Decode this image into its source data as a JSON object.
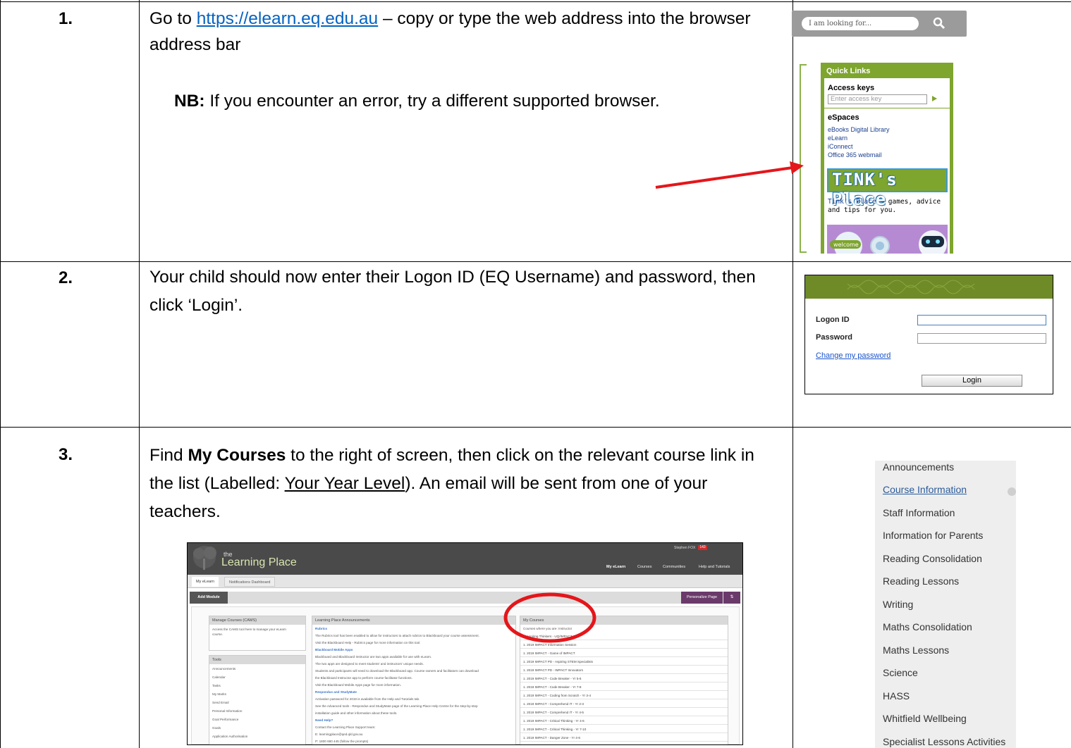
{
  "steps": [
    {
      "number": "1.",
      "text_before": "Go to ",
      "link": "https://elearn.eq.edu.au",
      "text_after": " – copy or type the web address into the browser address bar",
      "note_label": "NB:",
      "note_text": " If you encounter an error, try a different supported browser."
    },
    {
      "number": "2.",
      "text": "Your child should now enter their Logon ID (EQ Username) and password, then click ‘Login’."
    },
    {
      "number": "3.",
      "text_1": "Find ",
      "bold": "My Courses",
      "text_2": " to the right of screen, then click on the relevant course link in the list (Labelled: ",
      "underlined": "Your Year Level",
      "text_3": ").  An email will be sent from one of your teachers."
    }
  ],
  "search": {
    "placeholder": "I am looking for..."
  },
  "quick_links": {
    "title": "Quick Links",
    "access_keys": "Access keys",
    "access_placeholder": "Enter access key",
    "espaces": "eSpaces",
    "links": [
      "eBooks Digital Library",
      "eLearn",
      "iConnect",
      "Office 365 webmail"
    ],
    "tink_title": "TINK's Place",
    "tink_link": "Tink's Place",
    "tink_desc": " – games, advice and tips for you.",
    "welcome": "welcome"
  },
  "login": {
    "logon_label": "Logon ID",
    "password_label": "Password",
    "change_password": "Change my password",
    "button": "Login"
  },
  "course_menu": [
    "Announcements",
    "Course Information",
    "Staff Information",
    "Information for Parents",
    "Reading Consolidation",
    "Reading Lessons",
    "Writing",
    "Maths Consolidation",
    "Maths Lessons",
    "Science",
    "HASS",
    "Whitfield Wellbeing",
    "Specialist Lessons Activities"
  ],
  "learning_place": {
    "logo_the": "the",
    "logo": "Learning Place",
    "user": "Stephen FOX",
    "badge": "143",
    "nav": [
      "My eLearn",
      "Courses",
      "Communities",
      "Help and Tutorials"
    ],
    "tabs": [
      "My eLearn",
      "Notifications Dashboard"
    ],
    "add_module": "Add Module",
    "personalize": "Personalize Page",
    "manage_title": "Manage Courses (CAMS)",
    "manage_text_1": "Access the CAMS tool here to manage your eLearn",
    "manage_text_2": "course.",
    "tools_title": "Tools",
    "tools": [
      "Announcements",
      "Calendar",
      "Tasks",
      "My Marks",
      "Send Email",
      "Personal Information",
      "Goal Performance",
      "Goals",
      "Application Authorisation"
    ],
    "announce_title": "Learning Place Announcements",
    "announce_lines": [
      {
        "t": "Rubrics",
        "h": true
      },
      {
        "t": "The Rubrics tool has been enabled to allow for instructors to attach rubrics to Blackboard your course assessment.",
        "h": false
      },
      {
        "t": "Visit the Blackboard Help - Rubrics page for more information on this tool.",
        "h": false
      },
      {
        "t": "Blackboard Mobile Apps",
        "h": true
      },
      {
        "t": "Blackboard and Blackboard Instructor are two apps available for use with eLearn.",
        "h": false
      },
      {
        "t": "The two apps are designed to meet students' and instructors' unique needs.",
        "h": false
      },
      {
        "t": "Students and participants will need to download the Blackboard app. Course owners and facilitators can download",
        "h": false
      },
      {
        "t": "the Blackboard Instructor app to perform course facilitator functions.",
        "h": false
      },
      {
        "t": "Visit the Blackboard Mobile Apps page for more information.",
        "h": false
      },
      {
        "t": "Respondus and StudyMate",
        "h": true
      },
      {
        "t": "Activation password for 2019 is available from the Help and Tutorials tab.",
        "h": false
      },
      {
        "t": "See the Advanced tools - Respondus and StudyMate page of the Learning Place Help Centre for the step-by-step",
        "h": false
      },
      {
        "t": "installation guide and other information about these tools.",
        "h": false
      },
      {
        "t": "Need Help?",
        "h": true
      },
      {
        "t": "Contact the Learning Place Support team:",
        "h": false
      },
      {
        "t": "E: learningplace@qed.qld.gov.au",
        "h": false
      },
      {
        "t": "P: 1800 680 445 (follow the prompts)",
        "h": false
      }
    ],
    "courses_title": "My Courses",
    "courses_sub": "Courses where you are: Instructor",
    "courses": [
      "1. Aspiring Thinkers - UQ/IMPACT Cl...",
      "1. 2019 IMPACT Information Session",
      "1. 2019 IMPACT - Game of IMPACT",
      "1. 2019 IMPACT PD - Aspiring STEM Specialists",
      "1. 2019 IMPACT PD - IMPACT Innovators",
      "1. 2019 IMPACT - Code Breaker - Yr 5-6",
      "1. 2019 IMPACT - Code Breaker - Yr 7-8",
      "1. 2019 IMPACT - Coding from Scratch - Yr 3-4",
      "1. 2019 IMPACT - Comprehend IT - Yr 2-3",
      "1. 2019 IMPACT - Comprehend IT - Yr 4-5",
      "1. 2019 IMPACT - Critical Thinking - Yr 4-6",
      "1. 2019 IMPACT - Critical Thinking - Yr 7-10",
      "1. 2019 IMPACT - Danger Zone - Yr 4-6"
    ]
  },
  "colors": {
    "arrow": "#e4161b",
    "circle": "#e4161b",
    "green": "#7ea52e",
    "link": "#0563c1"
  }
}
